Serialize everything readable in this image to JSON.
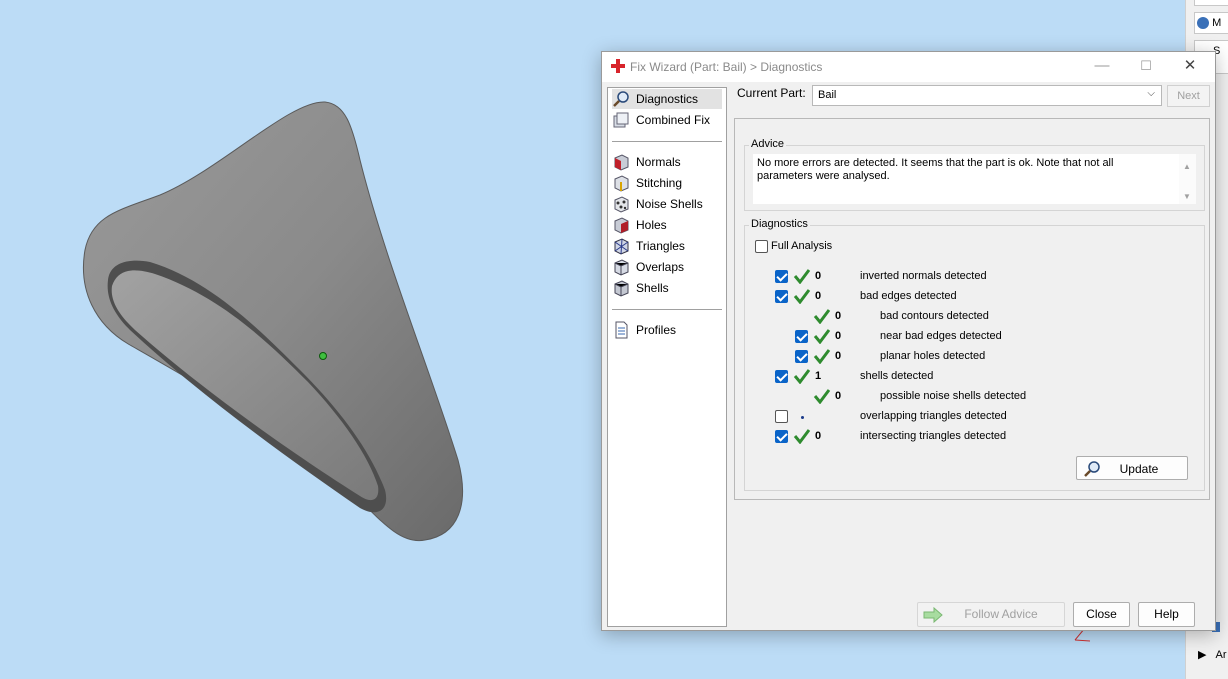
{
  "dialog": {
    "title": "Fix Wizard (Part: Bail) > Diagnostics",
    "minimize": "—",
    "maximize": "☐",
    "close": "✕"
  },
  "nav": {
    "items": [
      {
        "label": "Diagnostics",
        "icon": "magnifier-icon"
      },
      {
        "label": "Combined Fix",
        "icon": "combined-fix-icon"
      },
      {
        "label": "Normals",
        "icon": "normals-cube-icon"
      },
      {
        "label": "Stitching",
        "icon": "stitching-cube-icon"
      },
      {
        "label": "Noise Shells",
        "icon": "noise-shells-icon"
      },
      {
        "label": "Holes",
        "icon": "holes-cube-icon"
      },
      {
        "label": "Triangles",
        "icon": "triangles-cube-icon"
      },
      {
        "label": "Overlaps",
        "icon": "overlaps-cube-icon"
      },
      {
        "label": "Shells",
        "icon": "shells-cube-icon"
      },
      {
        "label": "Profiles",
        "icon": "document-icon"
      }
    ]
  },
  "header": {
    "current_part_label": "Current Part:",
    "current_part_value": "Bail",
    "next_label": "Next"
  },
  "advice": {
    "title": "Advice",
    "text": "No more errors are detected. It seems that the part is ok. Note that not all parameters were analysed."
  },
  "diagnostics": {
    "title": "Diagnostics",
    "full_analysis_label": "Full Analysis",
    "full_analysis_checked": false,
    "rows": [
      {
        "label": "inverted normals detected",
        "value": "0",
        "checked": true,
        "indent": 0,
        "has_checkbox": true,
        "status": "ok"
      },
      {
        "label": "bad edges detected",
        "value": "0",
        "checked": true,
        "indent": 0,
        "has_checkbox": true,
        "status": "ok"
      },
      {
        "label": "bad contours detected",
        "value": "0",
        "checked": null,
        "indent": 1,
        "has_checkbox": false,
        "status": "ok"
      },
      {
        "label": "near bad edges detected",
        "value": "0",
        "checked": true,
        "indent": 1,
        "has_checkbox": true,
        "status": "ok"
      },
      {
        "label": "planar holes detected",
        "value": "0",
        "checked": true,
        "indent": 1,
        "has_checkbox": true,
        "status": "ok"
      },
      {
        "label": "shells detected",
        "value": "1",
        "checked": true,
        "indent": 0,
        "has_checkbox": true,
        "status": "ok"
      },
      {
        "label": "possible noise shells detected",
        "value": "0",
        "checked": null,
        "indent": 1,
        "has_checkbox": false,
        "status": "ok"
      },
      {
        "label": "overlapping triangles detected",
        "value": "",
        "checked": false,
        "indent": 0,
        "has_checkbox": true,
        "status": "not-analysed"
      },
      {
        "label": "intersecting triangles detected",
        "value": "0",
        "checked": true,
        "indent": 0,
        "has_checkbox": true,
        "status": "ok"
      }
    ],
    "update_label": "Update"
  },
  "footer": {
    "follow_advice_label": "Follow Advice",
    "close_label": "Close",
    "help_label": "Help"
  },
  "side_strip": {
    "cell1": "M",
    "cell2": "S",
    "cell3": "Ar"
  },
  "colors": {
    "viewport_bg": "#bcdcf6",
    "checkbox_accent": "#0a64c8",
    "ok_tick": "#2e8b2e",
    "model_gray": "#8c8c8c"
  }
}
